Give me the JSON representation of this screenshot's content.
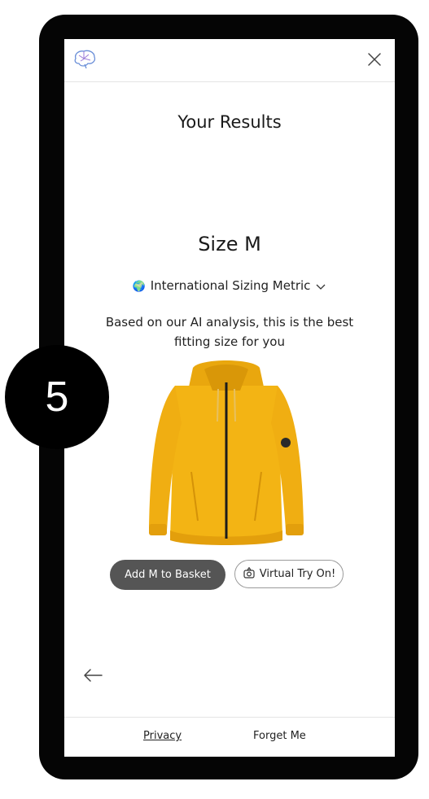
{
  "header": {
    "logo_icon": "brain-icon",
    "close_icon": "close-icon"
  },
  "results": {
    "title": "Your Results",
    "size_label": "Size M",
    "metric_selector": {
      "globe_icon": "🌍",
      "label": "International Sizing Metric",
      "chevron_icon": "chevron-down-icon"
    },
    "description": "Based on our AI analysis, this is the best fitting size for you",
    "product_image": "yellow-hoodie-image"
  },
  "actions": {
    "add_to_basket": "Add M to Basket",
    "virtual_try_on": "Virtual Try On!",
    "try_on_icon": "camera-icon"
  },
  "navigation": {
    "back_icon": "arrow-left-icon"
  },
  "footer": {
    "privacy": "Privacy",
    "forget_me": "Forget Me"
  },
  "step_badge": "5",
  "colors": {
    "product": "#f3b414",
    "basket_button": "#555555",
    "badge": "#000000"
  }
}
